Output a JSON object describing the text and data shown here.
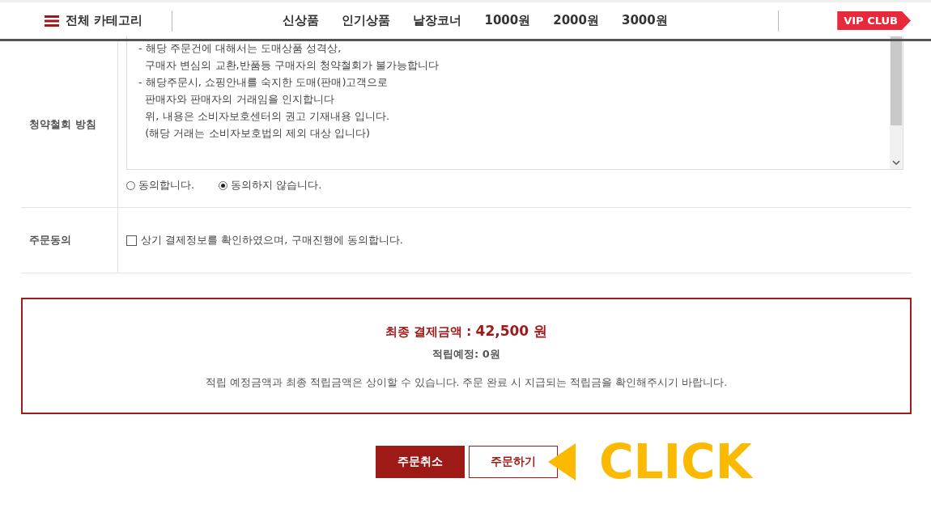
{
  "header": {
    "category_label": "전체 카테고리",
    "nav_items": [
      "신상품",
      "인기상품",
      "낱장코너",
      "1000원",
      "2000원",
      "3000원"
    ],
    "badge": "VIP CLUB"
  },
  "withdrawal": {
    "label": "청약철회 방침",
    "lines": [
      "- 해당 주문건에 대해서는 도매상품 성격상,",
      "  구매자 변심의 교환,반품등 구매자의 청약철회가 불가능합니다",
      "- 해당주문시, 쇼핑안내를 숙지한 도매(판매)고객으로",
      "  판매자와 판매자의 거래임을 인지합니다",
      "  위, 내용은 소비자보호센터의 권고 기재내용 입니다.",
      "  (해당 거래는 소비자보호법의 제외 대상 입니다)"
    ],
    "options": [
      {
        "label": "동의합니다.",
        "selected": false
      },
      {
        "label": "동의하지 않습니다.",
        "selected": true
      }
    ]
  },
  "agreement": {
    "label": "주문동의",
    "checkbox": {
      "label": "상기 결제정보를 확인하였으며, 구매진행에 동의합니다.",
      "checked": false
    }
  },
  "summary": {
    "total": "최종 결제금액 : **42,500 원**",
    "points": "적립예정: 0원",
    "notice": "적립 예정금액과 최종 적립금액은 상이할 수 있습니다. 주문 완료 시 지급되는 적립금을 확인해주시기 바랍니다."
  },
  "buttons": [
    {
      "label": "주문취소",
      "kind": "filled"
    },
    {
      "label": "주문하기",
      "kind": "outline"
    }
  ],
  "callout": "CLICK"
}
